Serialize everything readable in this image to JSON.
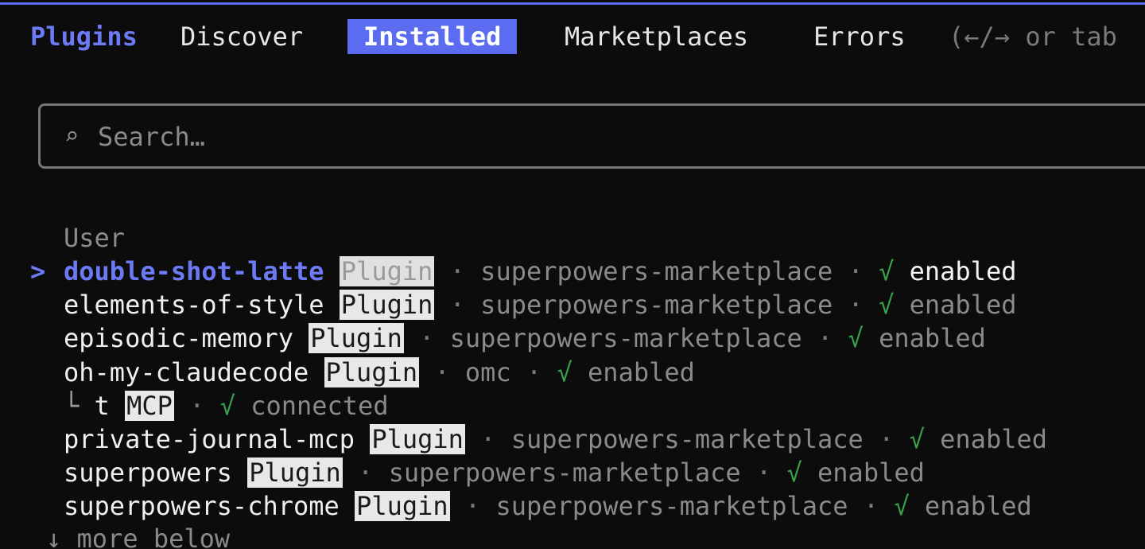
{
  "header": {
    "title": "Plugins",
    "tabs": [
      {
        "label": "Discover",
        "active": false
      },
      {
        "label": "Installed",
        "active": true
      },
      {
        "label": "Marketplaces",
        "active": false
      },
      {
        "label": "Errors",
        "active": false
      }
    ],
    "hint": "(←/→ or tab"
  },
  "search": {
    "icon": "search-icon",
    "placeholder": "Search…"
  },
  "section": {
    "label": "User"
  },
  "items": [
    {
      "name": "double-shot-latte",
      "badge": "Plugin",
      "marketplace": "superpowers-marketplace",
      "check": "√",
      "status": "enabled",
      "selected": true,
      "cursor": ">"
    },
    {
      "name": "elements-of-style",
      "badge": "Plugin",
      "marketplace": "superpowers-marketplace",
      "check": "√",
      "status": "enabled"
    },
    {
      "name": "episodic-memory",
      "badge": "Plugin",
      "marketplace": "superpowers-marketplace",
      "check": "√",
      "status": "enabled"
    },
    {
      "name": "oh-my-claudecode",
      "badge": "Plugin",
      "marketplace": "omc",
      "check": "√",
      "status": "enabled"
    },
    {
      "name": "t",
      "badge": "MCP",
      "tree": "└",
      "check": "√",
      "status": "connected",
      "child": true
    },
    {
      "name": "private-journal-mcp",
      "badge": "Plugin",
      "marketplace": "superpowers-marketplace",
      "check": "√",
      "status": "enabled"
    },
    {
      "name": "superpowers",
      "badge": "Plugin",
      "marketplace": "superpowers-marketplace",
      "check": "√",
      "status": "enabled"
    },
    {
      "name": "superpowers-chrome",
      "badge": "Plugin",
      "marketplace": "superpowers-marketplace",
      "check": "√",
      "status": "enabled"
    }
  ],
  "separator": "·",
  "footer": {
    "more": "↓ more below"
  },
  "colors": {
    "accent": "#5b6cf0",
    "check": "#3aa24a",
    "muted": "#8a8a8a",
    "background": "#0c0c0d"
  }
}
